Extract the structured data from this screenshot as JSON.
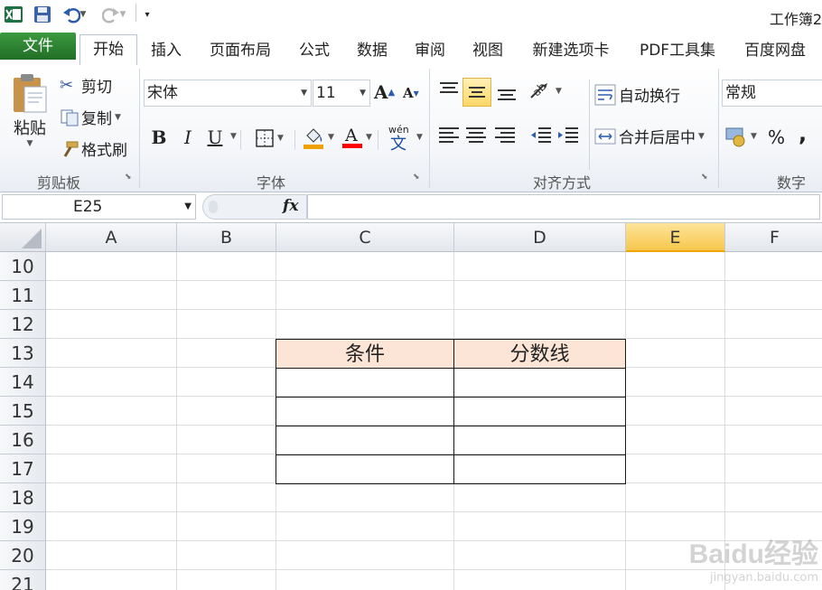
{
  "app": {
    "title": "工作簿2",
    "excel_icon": "excel-logo-icon",
    "brand_color": "#217346"
  },
  "quick_access": {
    "save_icon": "save-icon",
    "undo_icon": "undo-icon",
    "redo_icon": "redo-icon",
    "customize_icon": "customize-toolbar-icon"
  },
  "tabs": [
    {
      "label": "文件"
    },
    {
      "label": "开始"
    },
    {
      "label": "插入"
    },
    {
      "label": "页面布局"
    },
    {
      "label": "公式"
    },
    {
      "label": "数据"
    },
    {
      "label": "审阅"
    },
    {
      "label": "视图"
    },
    {
      "label": "新建选项卡"
    },
    {
      "label": "PDF工具集"
    },
    {
      "label": "百度网盘"
    }
  ],
  "ribbon": {
    "clipboard": {
      "label": "剪贴板",
      "paste": "粘贴",
      "cut": "剪切",
      "copy": "复制",
      "format_painter": "格式刷"
    },
    "font": {
      "label": "字体",
      "font_name": "宋体",
      "font_size": "11",
      "bold": "B",
      "italic": "I",
      "underline": "U",
      "font_color": "#ff0000"
    },
    "alignment": {
      "label": "对齐方式",
      "wrap_text": "自动换行",
      "merge_center": "合并后居中"
    },
    "number": {
      "label": "数字",
      "format": "常规",
      "percent": "%",
      "comma": ","
    }
  },
  "formula_bar": {
    "name_box": "E25",
    "fx": "fx",
    "formula": ""
  },
  "sheet": {
    "columns": [
      "A",
      "B",
      "C",
      "D",
      "E",
      "F"
    ],
    "rows": [
      "10",
      "11",
      "12",
      "13",
      "14",
      "15",
      "16",
      "17",
      "18",
      "19",
      "20",
      "21"
    ],
    "selected_column": "E",
    "table": {
      "header_fill": "#fce4d6",
      "headers": [
        "条件",
        "分数线"
      ],
      "rows": [
        [
          "",
          ""
        ],
        [
          "",
          ""
        ],
        [
          "",
          ""
        ],
        [
          "",
          ""
        ]
      ]
    }
  },
  "watermark": {
    "logo": "Baidu经验",
    "url": "jingyan.baidu.com"
  }
}
